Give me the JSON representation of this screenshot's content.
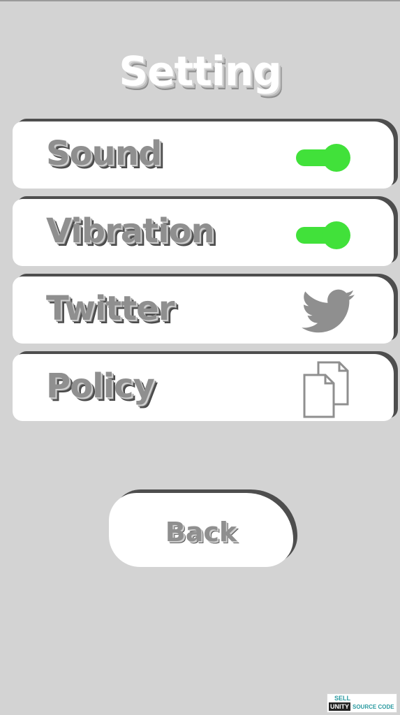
{
  "header": {
    "title": "Setting"
  },
  "settings": {
    "items": [
      {
        "label": "Sound",
        "control": "toggle",
        "on": true
      },
      {
        "label": "Vibration",
        "control": "toggle",
        "on": true
      },
      {
        "label": "Twitter",
        "control": "icon",
        "icon": "twitter-bird-icon"
      },
      {
        "label": "Policy",
        "control": "icon",
        "icon": "documents-icon"
      }
    ],
    "toggle_on_color": "#41e13a"
  },
  "footer": {
    "back_label": "Back"
  },
  "watermark": {
    "top": "SELL",
    "brand": "UNITY",
    "bottom": "SOURCE CODE"
  },
  "colors": {
    "background": "#d3d3d3",
    "card": "#ffffff",
    "card_shadow": "#4e4e4e",
    "label": "#8f8f8f"
  }
}
